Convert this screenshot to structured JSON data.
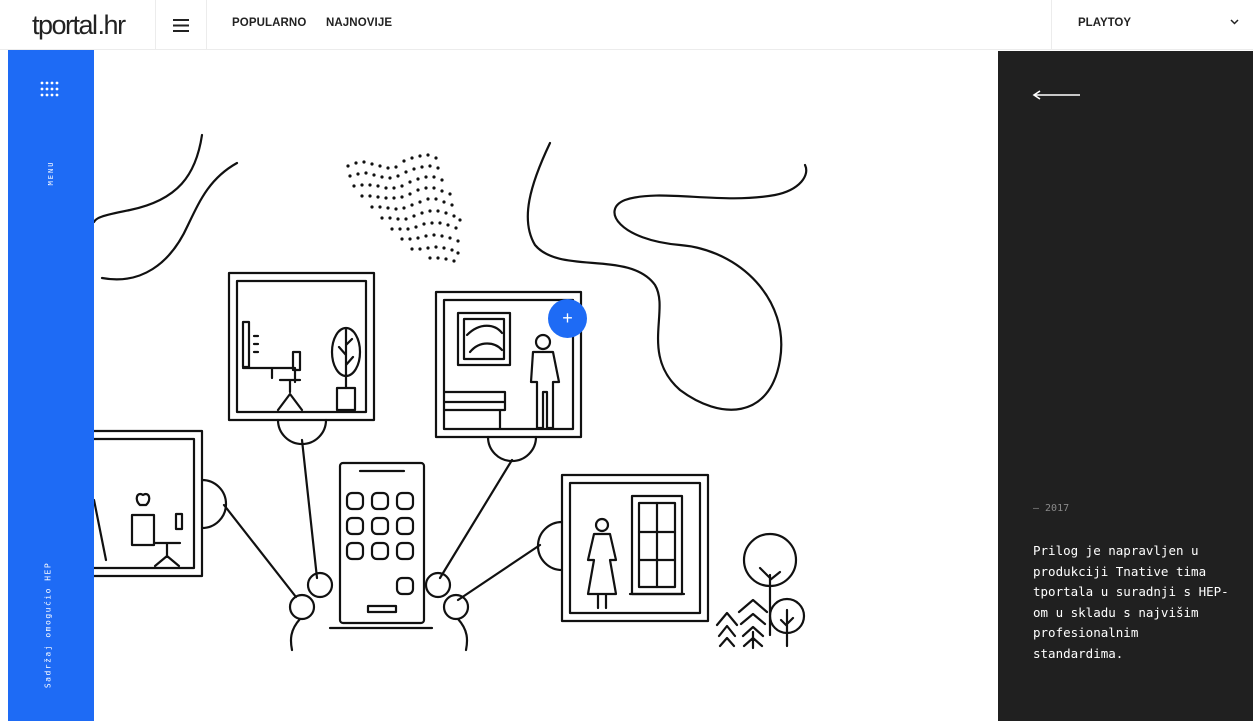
{
  "header": {
    "logo_part1": "tportal",
    "logo_part2": ".hr",
    "nav": [
      "POPULARNO",
      "NAJNOVIJE"
    ],
    "section_selector": "PLAYTOY",
    "menu_icon": "hamburger-icon",
    "selector_icon": "chevron-down-icon"
  },
  "sidebar": {
    "menu_label": "MENU",
    "menu_icon": "dots-grid-icon",
    "sponsor_text": "Sadržaj omogućio HEP",
    "color": "#1e6bf5"
  },
  "illustration": {
    "hotspot_label": "+",
    "hotspot_color": "#1e6bf5"
  },
  "panel": {
    "back_icon": "arrow-left-icon",
    "year": "– 2017",
    "description": "Prilog je napravljen u produkciji Tnative tima tportala u suradnji s HEP-om u skladu s najvišim profesionalnim standardima.",
    "background": "#202020"
  }
}
